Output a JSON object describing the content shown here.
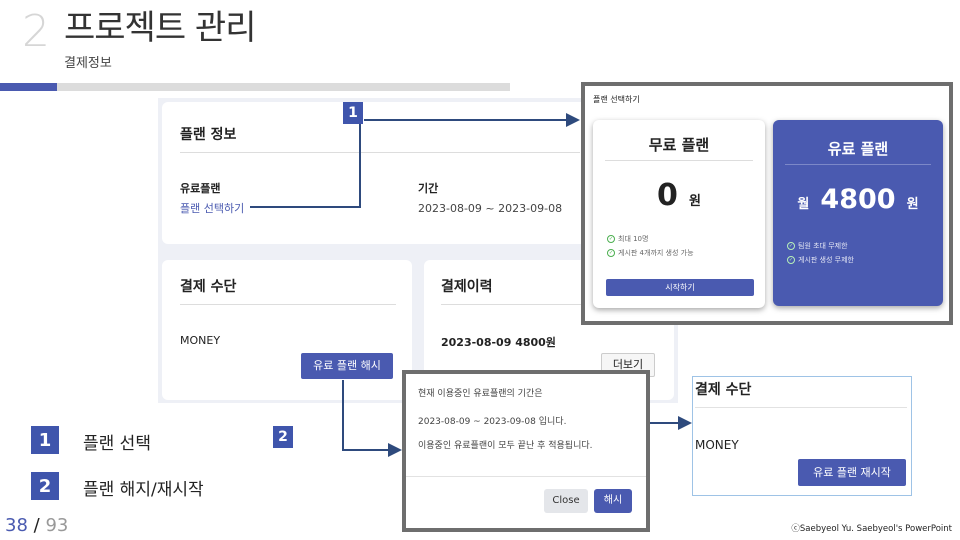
{
  "slide": {
    "number": "2",
    "title": "프로젝트 관리",
    "subtitle": "결제정보",
    "page_current": "38",
    "page_sep": "/",
    "page_total": "93",
    "credit": "ⓒSaebyeol Yu. Saebyeol's PowerPoint"
  },
  "plan_info": {
    "title": "플랜 정보",
    "plan_label": "유료플랜",
    "plan_link": "플랜 선택하기",
    "period_label": "기간",
    "period_value": "2023-08-09 ~ 2023-09-08"
  },
  "payment_method": {
    "title": "결제 수단",
    "method": "MONEY",
    "cancel_button": "유료 플랜 해시"
  },
  "payment_history": {
    "title": "결제이력",
    "entry": "2023-08-09 4800원",
    "more_button": "더보기",
    "partial_digit": "2"
  },
  "plan_modal": {
    "header": "플랜 선택하기",
    "free": {
      "title": "무료 플랜",
      "price": "0",
      "unit": "원",
      "features": [
        "최대 10명",
        "게시판 4개까지 생성 가능"
      ],
      "start_button": "시작하기"
    },
    "paid": {
      "title": "유료 플랜",
      "prefix": "월",
      "price": "4800",
      "unit": "원",
      "features": [
        "팀원 초대 무제한",
        "게시판 생성 무제한"
      ]
    }
  },
  "cancel_modal": {
    "line1": "현재 이용중인 유료플랜의 기간은",
    "line2": "2023-08-09 ~ 2023-09-08 입니다.",
    "line3": "이용중인 유료플랜이 모두 끝난 후 적용됩니다.",
    "close_button": "Close",
    "confirm_button": "해시"
  },
  "result_card": {
    "title": "결제 수단",
    "method": "MONEY",
    "restart_button": "유료 플랜 재시작"
  },
  "callouts": {
    "one": "1",
    "two": "2"
  },
  "legend": [
    {
      "num": "1",
      "label": "플랜 선택"
    },
    {
      "num": "2",
      "label": "플랜 해지/재시작"
    }
  ],
  "colors": {
    "accent": "#4a5ab0",
    "callout": "#3f55ac",
    "arrow": "#2e4a7d"
  }
}
